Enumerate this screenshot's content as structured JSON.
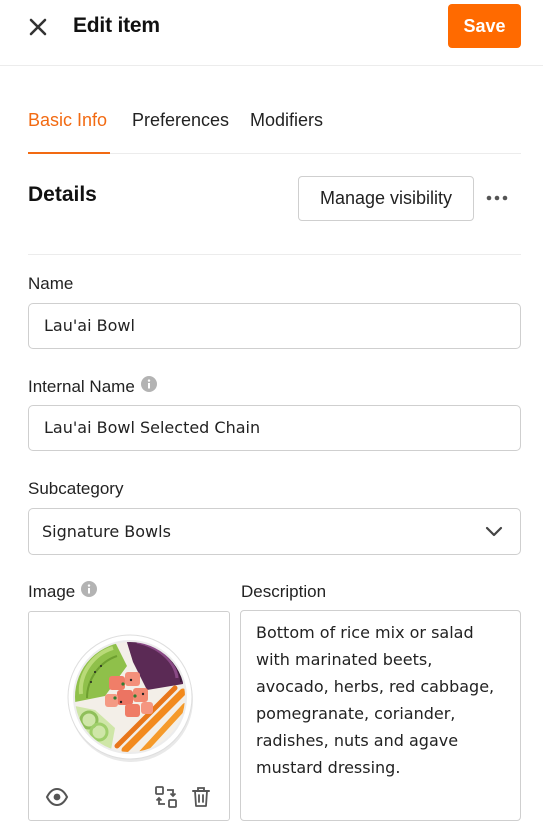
{
  "header": {
    "title": "Edit item",
    "save_label": "Save",
    "close_icon": "close-icon"
  },
  "tabs": [
    {
      "label": "Basic Info",
      "active": true
    },
    {
      "label": "Preferences",
      "active": false
    },
    {
      "label": "Modifiers",
      "active": false
    }
  ],
  "details": {
    "title": "Details",
    "manage_visibility_label": "Manage visibility",
    "more_icon": "more-horizontal-icon"
  },
  "form": {
    "name_label": "Name",
    "name_value": "Lau'ai Bowl",
    "internal_name_label": "Internal Name",
    "internal_name_value": "Lau'ai Bowl Selected Chain",
    "subcategory_label": "Subcategory",
    "subcategory_value": "Signature Bowls",
    "image_label": "Image",
    "description_label": "Description",
    "description_value": "Bottom of rice mix or salad with marinated beets, avocado, herbs, red cabbage, pomegranate, coriander, radishes, nuts and agave mustard dressing."
  },
  "image_actions": {
    "preview_icon": "eye-icon",
    "replace_icon": "replace-image-icon",
    "delete_icon": "trash-icon"
  },
  "colors": {
    "accent": "#ff6a00",
    "tab_active": "#f26a12",
    "border": "#cfcfcf"
  }
}
